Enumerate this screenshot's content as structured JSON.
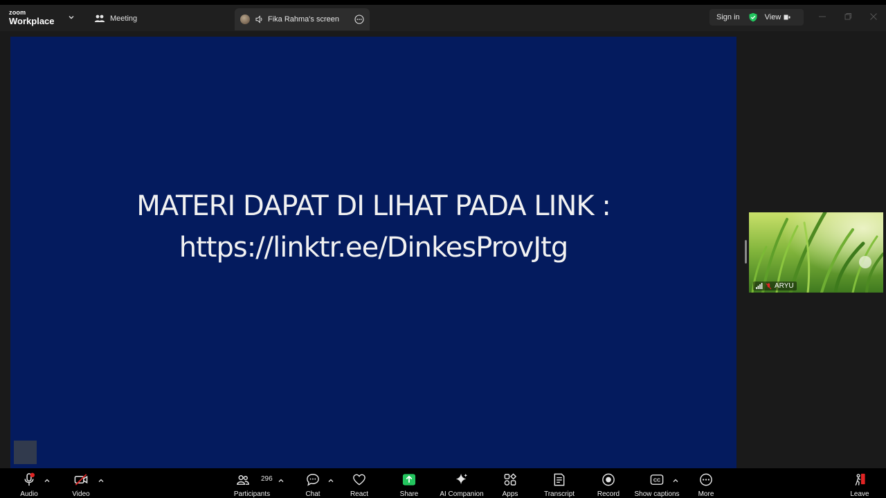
{
  "app": {
    "logo_line1": "zoom",
    "logo_line2": "Workplace"
  },
  "titlebar": {
    "meeting_label": "Meeting",
    "screen_tab_label": "Fika Rahma's screen",
    "sign_in_label": "Sign in",
    "view_label": "View"
  },
  "slide": {
    "line1": "MATERI DAPAT DI LIHAT PADA LINK :",
    "line2": "https://linktr.ee/DinkesProvJtg"
  },
  "video_tile": {
    "name": "ARYU"
  },
  "toolbar": {
    "audio_label": "Audio",
    "video_label": "Video",
    "participants_label": "Participants",
    "participants_count": "296",
    "chat_label": "Chat",
    "react_label": "React",
    "share_label": "Share",
    "ai_companion_label": "AI Companion",
    "apps_label": "Apps",
    "transcript_label": "Transcript",
    "record_label": "Record",
    "captions_label": "Show captions",
    "more_label": "More",
    "leave_label": "Leave"
  },
  "colors": {
    "share_bg": "#041b5e",
    "share_green": "#23c55e",
    "shield_green": "#22c55e",
    "muted_red": "#e02424"
  }
}
